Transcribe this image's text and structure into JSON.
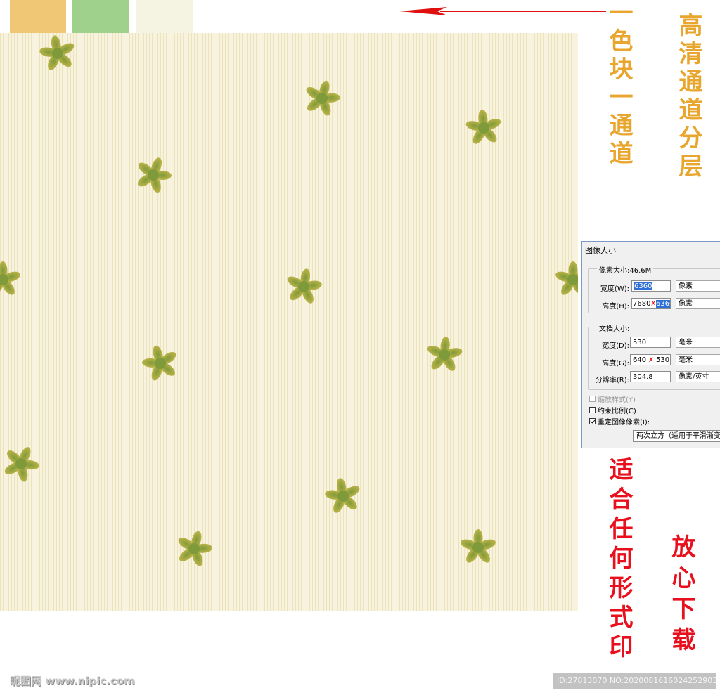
{
  "swatches": [
    {
      "name": "swatch-orange",
      "color": "#f0c774"
    },
    {
      "name": "swatch-green",
      "color": "#9fd08c"
    },
    {
      "name": "swatch-cream",
      "color": "#f5f3e2"
    }
  ],
  "colors": {
    "pattern_bg": "#f7f3df",
    "stripe": "#ece3bd",
    "flower_light": "#c6b84a",
    "flower_dark": "#7f9a3a",
    "arrow": "#e01010",
    "gold_text": "#e8a62e",
    "red_text": "#e8101c"
  },
  "annotations": {
    "left_vertical": "一色块一通道",
    "right_vertical": "高清通道分层",
    "red_left": "适合任何形式印",
    "red_right": "放心下载"
  },
  "dialog": {
    "title": "图像大小",
    "pixel_size_legend": "像素大小:46.6M",
    "width_label": "宽度(W):",
    "width_value": "6360",
    "width_unit": "像素",
    "height_label": "高度(H):",
    "height_old": "7680",
    "height_value": "6360",
    "height_unit": "像素",
    "doc_size_legend": "文档大小:",
    "doc_width_label": "宽度(D):",
    "doc_width_value": "530",
    "doc_width_unit": "毫米",
    "doc_height_label": "高度(G):",
    "doc_height_old": "640",
    "doc_height_value": "530",
    "doc_height_unit": "毫米",
    "resolution_label": "分辨率(R):",
    "resolution_value": "304.8",
    "resolution_unit": "像素/英寸",
    "scale_styles_label": "缩放样式(Y)",
    "constrain_label": "约束比例(C)",
    "resample_label": "重定图像像素(I):",
    "resample_value": "两次立方（适用于平滑渐变"
  },
  "watermark": {
    "left": "昵图网 www.nipic.com",
    "right": "ID:27813070 NO:20200816160242529031"
  }
}
